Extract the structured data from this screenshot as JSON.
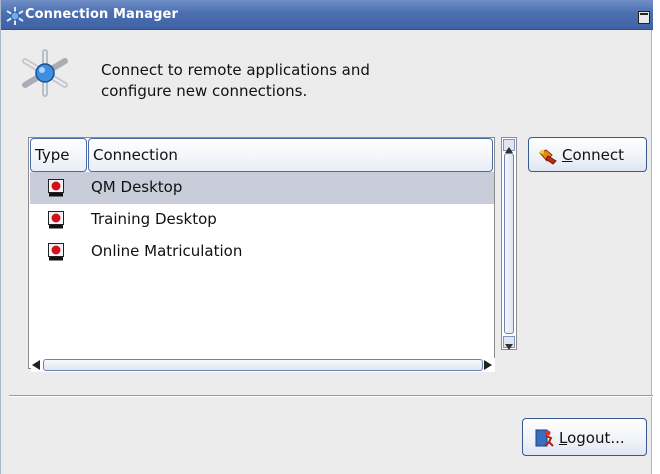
{
  "window": {
    "title": "Connection Manager"
  },
  "description": {
    "line1": "Connect to remote applications and",
    "line2": "configure new connections."
  },
  "table": {
    "columns": [
      "Type",
      "Connection"
    ],
    "rows": [
      {
        "type_icon": "connection-type-icon",
        "connection": "QM Desktop",
        "selected": true
      },
      {
        "type_icon": "connection-type-icon",
        "connection": "Training Desktop",
        "selected": false
      },
      {
        "type_icon": "connection-type-icon",
        "connection": "Online Matriculation",
        "selected": false
      }
    ]
  },
  "buttons": {
    "connect": {
      "label_underlined": "C",
      "label_rest": "onnect",
      "icon": "connect-plug-icon"
    },
    "logout": {
      "label_underlined": "L",
      "label_rest": "ogout...",
      "icon": "logout-figure-icon"
    }
  },
  "colors": {
    "titlebar": "#4b6fb0",
    "selection": "#c9ccd9",
    "button_border": "#37598f"
  }
}
